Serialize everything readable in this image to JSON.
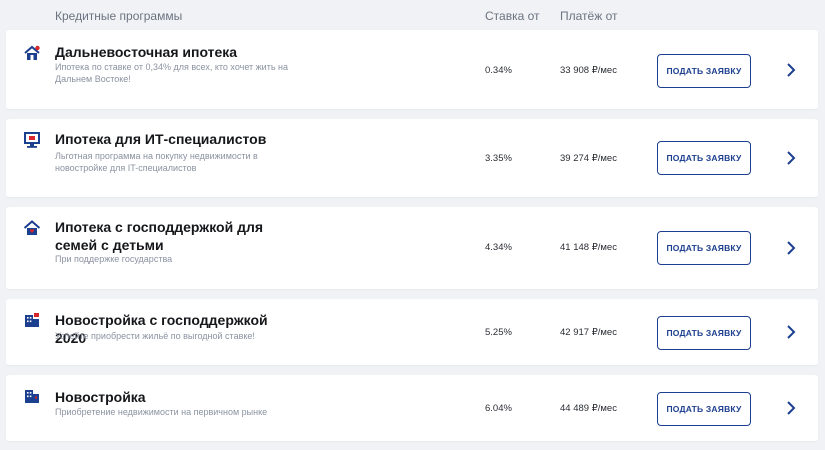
{
  "header": {
    "programs_label": "Кредитные программы",
    "rate_label": "Ставка от",
    "payment_label": "Платёж от"
  },
  "colors": {
    "accent": "#1d3f8f",
    "icon_red": "#d9262b",
    "background": "#f0f2f5"
  },
  "programs": [
    {
      "title": "Дальневосточная ипотека",
      "description": "Ипотека по ставке от 0,34% для всех, кто хочет жить на Дальнем Востоке!",
      "rate": "0.34%",
      "payment": "33 908 ₽/мес",
      "button": "ПОДАТЬ ЗАЯВКУ",
      "icon": "house-sun-icon"
    },
    {
      "title": "Ипотека для ИТ-специалистов",
      "description": "Льготная программа на покупку недвижимости в новостройке для IT-специалистов",
      "rate": "3.35%",
      "payment": "39 274 ₽/мес",
      "button": "ПОДАТЬ ЗАЯВКУ",
      "icon": "monitor-icon"
    },
    {
      "title": "Ипотека с господдержкой для семей с детьми",
      "description": "При поддержке государства",
      "rate": "4.34%",
      "payment": "41 148 ₽/мес",
      "button": "ПОДАТЬ ЗАЯВКУ",
      "icon": "family-house-icon"
    },
    {
      "title": "Новостройка с господдержкой 2020",
      "description": "Успейте приобрести жильё по выгодной ставке!",
      "rate": "5.25%",
      "payment": "42 917 ₽/мес",
      "button": "ПОДАТЬ ЗАЯВКУ",
      "icon": "building-flag-icon"
    },
    {
      "title": "Новостройка",
      "description": "Приобретение недвижимости на первичном рынке",
      "rate": "6.04%",
      "payment": "44 489 ₽/мес",
      "button": "ПОДАТЬ ЗАЯВКУ",
      "icon": "building-icon"
    }
  ]
}
